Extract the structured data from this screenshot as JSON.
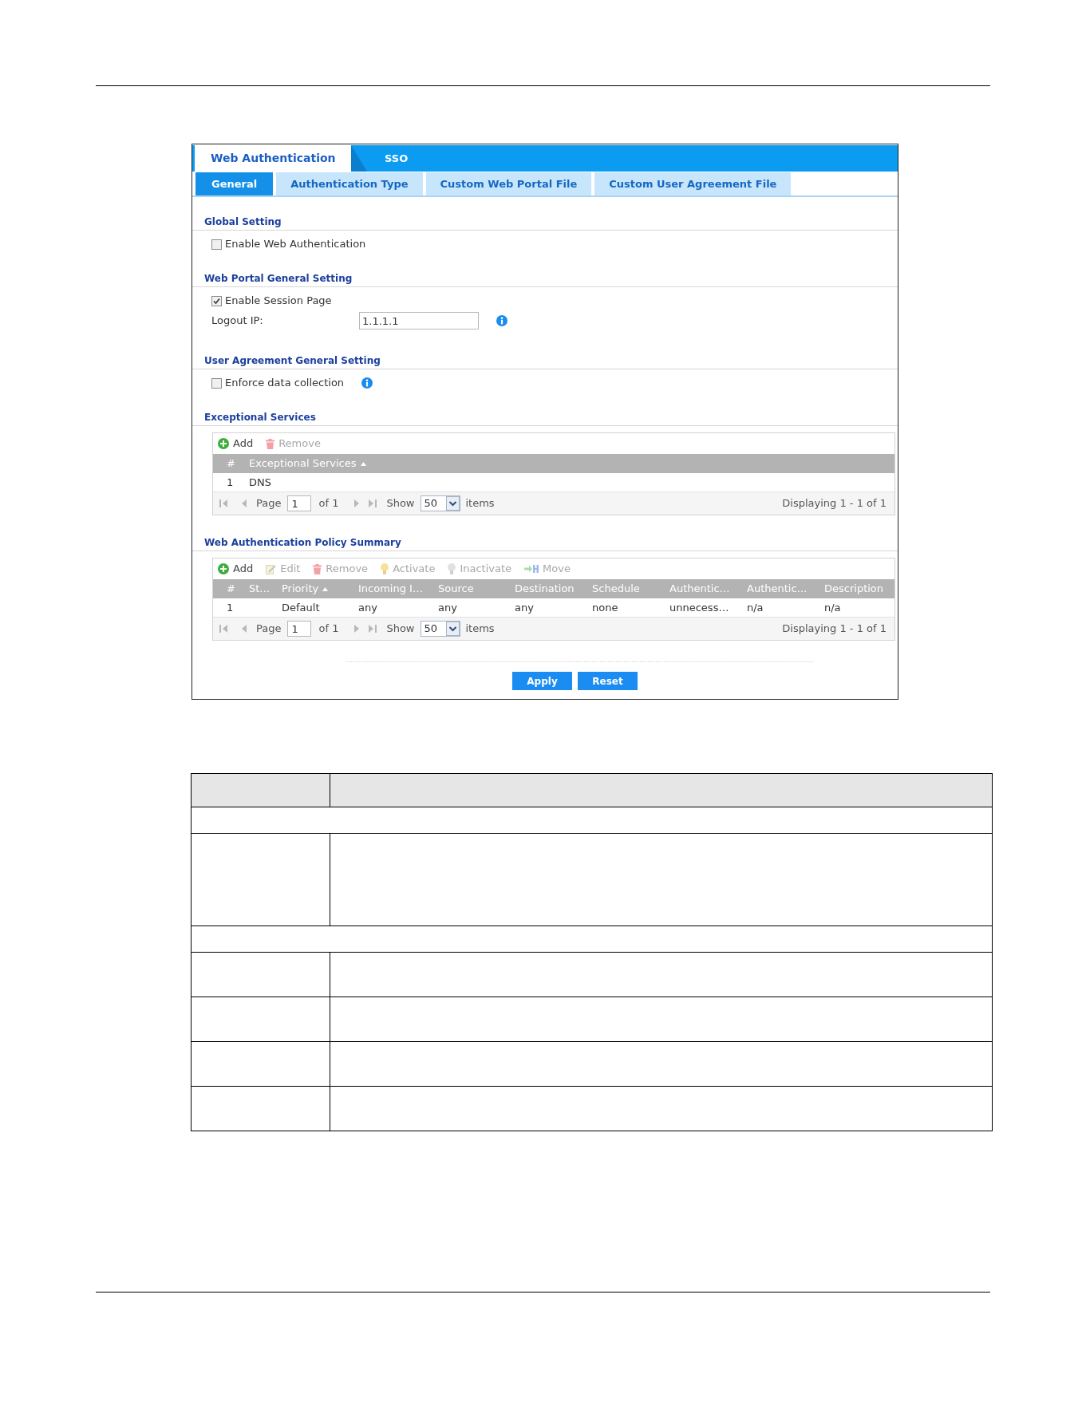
{
  "tabs": [
    {
      "label": "Web Authentication",
      "selected": true
    },
    {
      "label": "SSO",
      "selected": false
    }
  ],
  "sub_tabs": [
    {
      "label": "General",
      "selected": true
    },
    {
      "label": "Authentication Type",
      "selected": false
    },
    {
      "label": "Custom Web Portal File",
      "selected": false
    },
    {
      "label": "Custom User Agreement File",
      "selected": false
    }
  ],
  "sections": [
    {
      "title": "Global Setting",
      "fields": [
        {
          "kind": "checkbox",
          "label": "Enable Web Authentication",
          "checked": false
        }
      ]
    },
    {
      "title": "Web Portal General Setting",
      "fields": [
        {
          "kind": "checkbox",
          "label": "Enable Session Page",
          "checked": true
        },
        {
          "kind": "text",
          "label": "Logout IP:",
          "value": "1.1.1.1",
          "info": true
        }
      ]
    },
    {
      "title": "User Agreement General Setting",
      "fields": [
        {
          "kind": "checkbox",
          "label": "Enforce data collection",
          "checked": false,
          "info": true
        }
      ]
    },
    {
      "title": "Exceptional Services",
      "grid": {
        "toolbar": [
          {
            "kind": "add",
            "label": "Add",
            "disabled": false
          },
          {
            "kind": "remove",
            "label": "Remove",
            "disabled": true
          }
        ],
        "columns": [
          {
            "label": "#",
            "sorted": false
          },
          {
            "label": "Exceptional Services",
            "sorted": true
          }
        ],
        "rows": [
          [
            "1",
            "DNS"
          ]
        ],
        "pager": {
          "page_label": "Page",
          "page": "1",
          "page_total": "of 1",
          "show_label": "Show",
          "page_size": "50",
          "items_label": "items",
          "summary": "Displaying 1 - 1 of 1"
        }
      }
    },
    {
      "title": "Web Authentication Policy Summary",
      "grid": {
        "toolbar": [
          {
            "kind": "add",
            "label": "Add",
            "disabled": false
          },
          {
            "kind": "edit",
            "label": "Edit",
            "disabled": true
          },
          {
            "kind": "remove",
            "label": "Remove",
            "disabled": true
          },
          {
            "kind": "activate",
            "label": "Activate",
            "disabled": true
          },
          {
            "kind": "inactivate",
            "label": "Inactivate",
            "disabled": true
          },
          {
            "kind": "move",
            "label": "Move",
            "disabled": true
          }
        ],
        "columns": [
          {
            "label": "#",
            "sorted": false
          },
          {
            "label": "St…",
            "sorted": false
          },
          {
            "label": "Priority",
            "sorted": true
          },
          {
            "label": "Incoming I…",
            "sorted": false
          },
          {
            "label": "Source",
            "sorted": false
          },
          {
            "label": "Destination",
            "sorted": false
          },
          {
            "label": "Schedule",
            "sorted": false
          },
          {
            "label": "Authentic…",
            "sorted": false
          },
          {
            "label": "Authentic…",
            "sorted": false
          },
          {
            "label": "Description",
            "sorted": false
          }
        ],
        "rows": [
          [
            "1",
            null,
            "Default",
            "any",
            "any",
            "any",
            "none",
            "unnecess…",
            "n/a",
            "n/a"
          ]
        ],
        "pager": {
          "page_label": "Page",
          "page": "1",
          "page_total": "of 1",
          "show_label": "Show",
          "page_size": "50",
          "items_label": "items",
          "summary": "Displaying 1 - 1 of 1"
        }
      }
    }
  ],
  "buttons": [
    "Apply",
    "Reset"
  ],
  "description_table": {
    "rows": [
      {
        "kind": "header"
      },
      {
        "kind": "section"
      },
      {
        "kind": "tall"
      },
      {
        "kind": "section"
      },
      {
        "kind": "row"
      },
      {
        "kind": "row"
      },
      {
        "kind": "row"
      },
      {
        "kind": "row"
      }
    ]
  }
}
